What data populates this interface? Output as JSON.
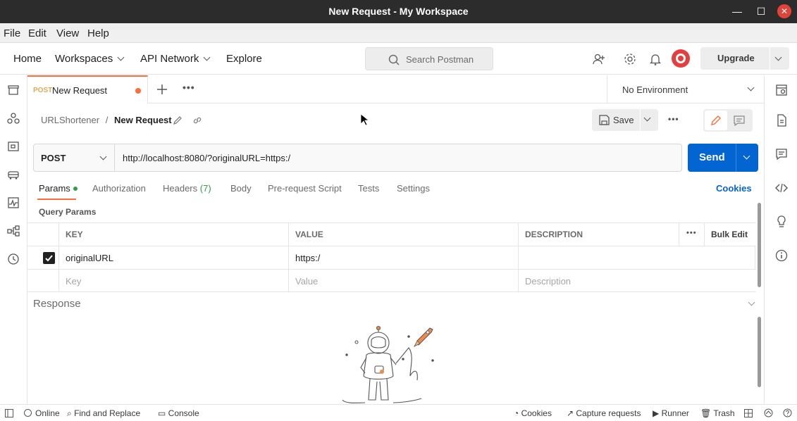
{
  "window": {
    "title": "New Request - My Workspace"
  },
  "menu": {
    "items": [
      "File",
      "Edit",
      "View",
      "Help"
    ]
  },
  "header": {
    "nav": [
      "Home",
      "Workspaces",
      "API Network",
      "Explore"
    ],
    "search_placeholder": "Search Postman",
    "upgrade_label": "Upgrade"
  },
  "tab": {
    "method": "POST",
    "name": "New Request"
  },
  "environment": {
    "selected": "No Environment"
  },
  "breadcrumb": {
    "collection": "URLShortener",
    "separator": "/",
    "request": "New Request"
  },
  "toolbar": {
    "save_label": "Save"
  },
  "request": {
    "method": "POST",
    "url": "http://localhost:8080/?originalURL=https:/",
    "send_label": "Send"
  },
  "request_tabs": {
    "params": "Params",
    "authorization": "Authorization",
    "headers": "Headers",
    "headers_count": "(7)",
    "body": "Body",
    "pre_request": "Pre-request Script",
    "tests": "Tests",
    "settings": "Settings",
    "cookies": "Cookies"
  },
  "query_params": {
    "title": "Query Params",
    "columns": {
      "key": "KEY",
      "value": "VALUE",
      "description": "DESCRIPTION",
      "bulk_edit": "Bulk Edit"
    },
    "rows": [
      {
        "key": "originalURL",
        "value": "https:/",
        "description": ""
      }
    ],
    "placeholder": {
      "key": "Key",
      "value": "Value",
      "description": "Description"
    }
  },
  "response": {
    "label": "Response"
  },
  "statusbar": {
    "online": "Online",
    "find_replace": "Find and Replace",
    "console": "Console",
    "cookies": "Cookies",
    "capture": "Capture requests",
    "runner": "Runner",
    "trash": "Trash"
  },
  "colors": {
    "accent": "#ff6c37",
    "primary": "#0265d2"
  }
}
